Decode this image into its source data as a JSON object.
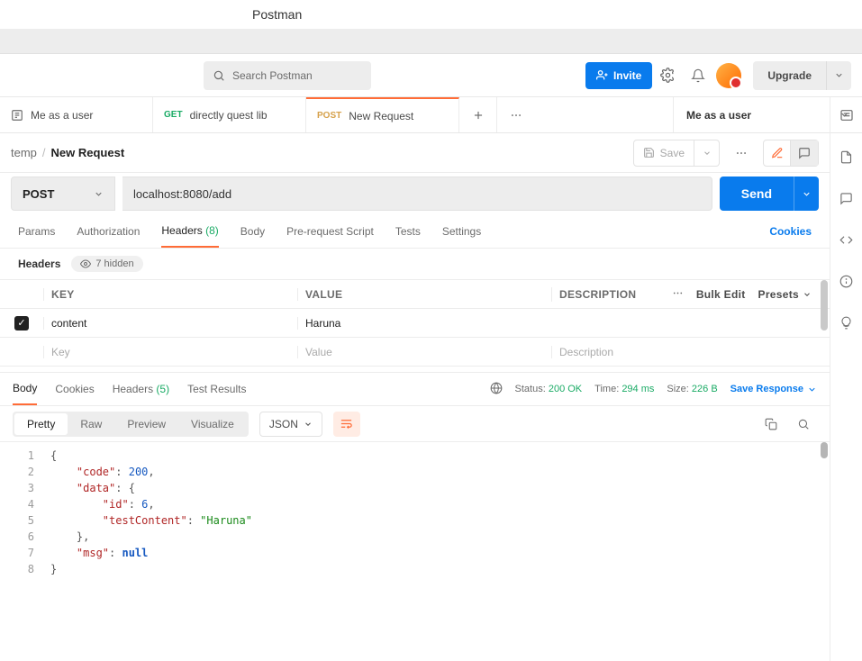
{
  "app_title": "Postman",
  "search_placeholder": "Search Postman",
  "invite_label": "Invite",
  "upgrade_label": "Upgrade",
  "tabs": [
    {
      "icon": "user",
      "label": "Me as a user"
    },
    {
      "method": "GET",
      "label": "directly quest lib"
    },
    {
      "method": "POST",
      "label": "New Request"
    }
  ],
  "env_selected": "Me as a user",
  "breadcrumb": {
    "parent": "temp",
    "current": "New Request"
  },
  "save_label": "Save",
  "method": "POST",
  "url": "localhost:8080/add",
  "send_label": "Send",
  "request_tabs": {
    "params": "Params",
    "auth": "Authorization",
    "headers": "Headers",
    "headers_count": "(8)",
    "body": "Body",
    "prereq": "Pre-request Script",
    "tests": "Tests",
    "settings": "Settings",
    "cookies": "Cookies"
  },
  "headers_sub": {
    "title": "Headers",
    "hidden": "7 hidden"
  },
  "table": {
    "hdr_key": "KEY",
    "hdr_value": "VALUE",
    "hdr_desc": "DESCRIPTION",
    "bulk": "Bulk Edit",
    "presets": "Presets",
    "rows": [
      {
        "key": "content",
        "value": "Haruna",
        "desc": ""
      }
    ],
    "ph_key": "Key",
    "ph_value": "Value",
    "ph_desc": "Description"
  },
  "response_tabs": {
    "body": "Body",
    "cookies": "Cookies",
    "headers": "Headers",
    "headers_count": "(5)",
    "tests": "Test Results"
  },
  "status": {
    "label": "Status:",
    "value": "200 OK"
  },
  "time": {
    "label": "Time:",
    "value": "294 ms"
  },
  "size": {
    "label": "Size:",
    "value": "226 B"
  },
  "save_response": "Save Response",
  "body_view": {
    "pretty": "Pretty",
    "raw": "Raw",
    "preview": "Preview",
    "visualize": "Visualize",
    "fmt": "JSON"
  },
  "response_json": {
    "code": 200,
    "data": {
      "id": 6,
      "testContent": "Haruna"
    },
    "msg": null
  }
}
